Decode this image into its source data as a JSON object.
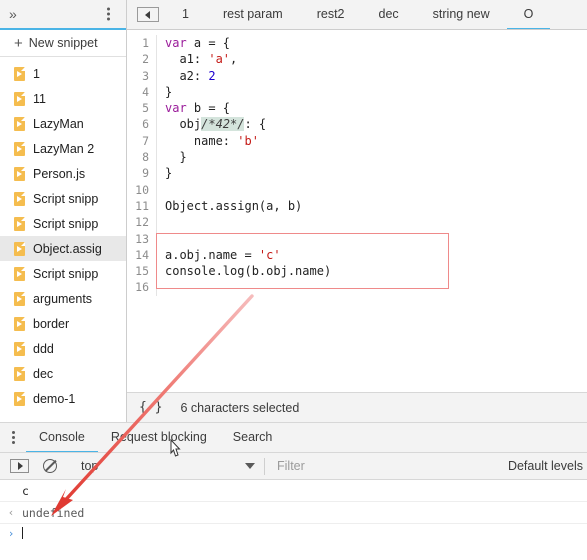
{
  "sidebar": {
    "more_tabs_icon": "chevron-double-right-icon",
    "kebab_icon": "more-options-icon",
    "new_snippet_label": "New snippet",
    "plus_icon": "plus-icon",
    "items": [
      {
        "label": "1",
        "selected": false
      },
      {
        "label": "11",
        "selected": false
      },
      {
        "label": "LazyMan",
        "selected": false
      },
      {
        "label": "LazyMan 2",
        "selected": false
      },
      {
        "label": "Person.js",
        "selected": false
      },
      {
        "label": "Script snipp",
        "selected": false
      },
      {
        "label": "Script snipp",
        "selected": false
      },
      {
        "label": "Object.assig",
        "selected": true
      },
      {
        "label": "Script snipp",
        "selected": false
      },
      {
        "label": "arguments",
        "selected": false
      },
      {
        "label": "border",
        "selected": false
      },
      {
        "label": "ddd",
        "selected": false
      },
      {
        "label": "dec",
        "selected": false
      },
      {
        "label": "demo-1",
        "selected": false
      }
    ]
  },
  "editor_tabs": {
    "nav_button_icon": "previous-tab-icon",
    "tabs": [
      {
        "label": "1",
        "active": false
      },
      {
        "label": "rest param",
        "active": false
      },
      {
        "label": "rest2",
        "active": false
      },
      {
        "label": "dec",
        "active": false
      },
      {
        "label": "string new",
        "active": false
      },
      {
        "label": "O",
        "active": true
      }
    ]
  },
  "code": {
    "lines": [
      {
        "n": "1",
        "html": "<span class='kw'>var</span> a = {"
      },
      {
        "n": "2",
        "html": "  a1: <span class='str'>'a'</span>,"
      },
      {
        "n": "3",
        "html": "  a2: <span class='num'>2</span>"
      },
      {
        "n": "4",
        "html": "}"
      },
      {
        "n": "5",
        "html": "<span class='kw'>var</span> b = {"
      },
      {
        "n": "6",
        "html": "  obj<span class='com hl'>/*42*/</span>: {"
      },
      {
        "n": "7",
        "html": "    name: <span class='str'>'b'</span>"
      },
      {
        "n": "8",
        "html": "  }"
      },
      {
        "n": "9",
        "html": "}"
      },
      {
        "n": "10",
        "html": ""
      },
      {
        "n": "11",
        "html": "Object.assign(a, b)"
      },
      {
        "n": "12",
        "html": ""
      },
      {
        "n": "13",
        "html": ""
      },
      {
        "n": "14",
        "html": "a.obj.name = <span class='str'>'c'</span>"
      },
      {
        "n": "15",
        "html": "console.log(b.obj.name)"
      },
      {
        "n": "16",
        "html": ""
      }
    ]
  },
  "status_bar": {
    "format_icon": "pretty-print-braces-icon",
    "text": "6 characters selected"
  },
  "drawer": {
    "kebab_icon": "more-tools-icon",
    "tabs": [
      {
        "label": "Console",
        "active": true
      },
      {
        "label": "Request blocking",
        "active": false
      },
      {
        "label": "Search",
        "active": false
      }
    ]
  },
  "console_toolbar": {
    "execute_icon": "execute-context-icon",
    "clear_icon": "clear-console-icon",
    "context": "top",
    "caret_icon": "chevron-down-icon",
    "filter_placeholder": "Filter",
    "levels_label": "Default levels"
  },
  "console_output": {
    "rows": [
      {
        "gutter": "",
        "text": "c",
        "kind": "log"
      },
      {
        "gutter": "‹",
        "text": "undefined",
        "kind": "result"
      }
    ],
    "prompt_icon": "console-prompt-icon"
  },
  "annotation": {
    "box_color": "#ef8a8a",
    "arrow_color": "#e8463f"
  }
}
